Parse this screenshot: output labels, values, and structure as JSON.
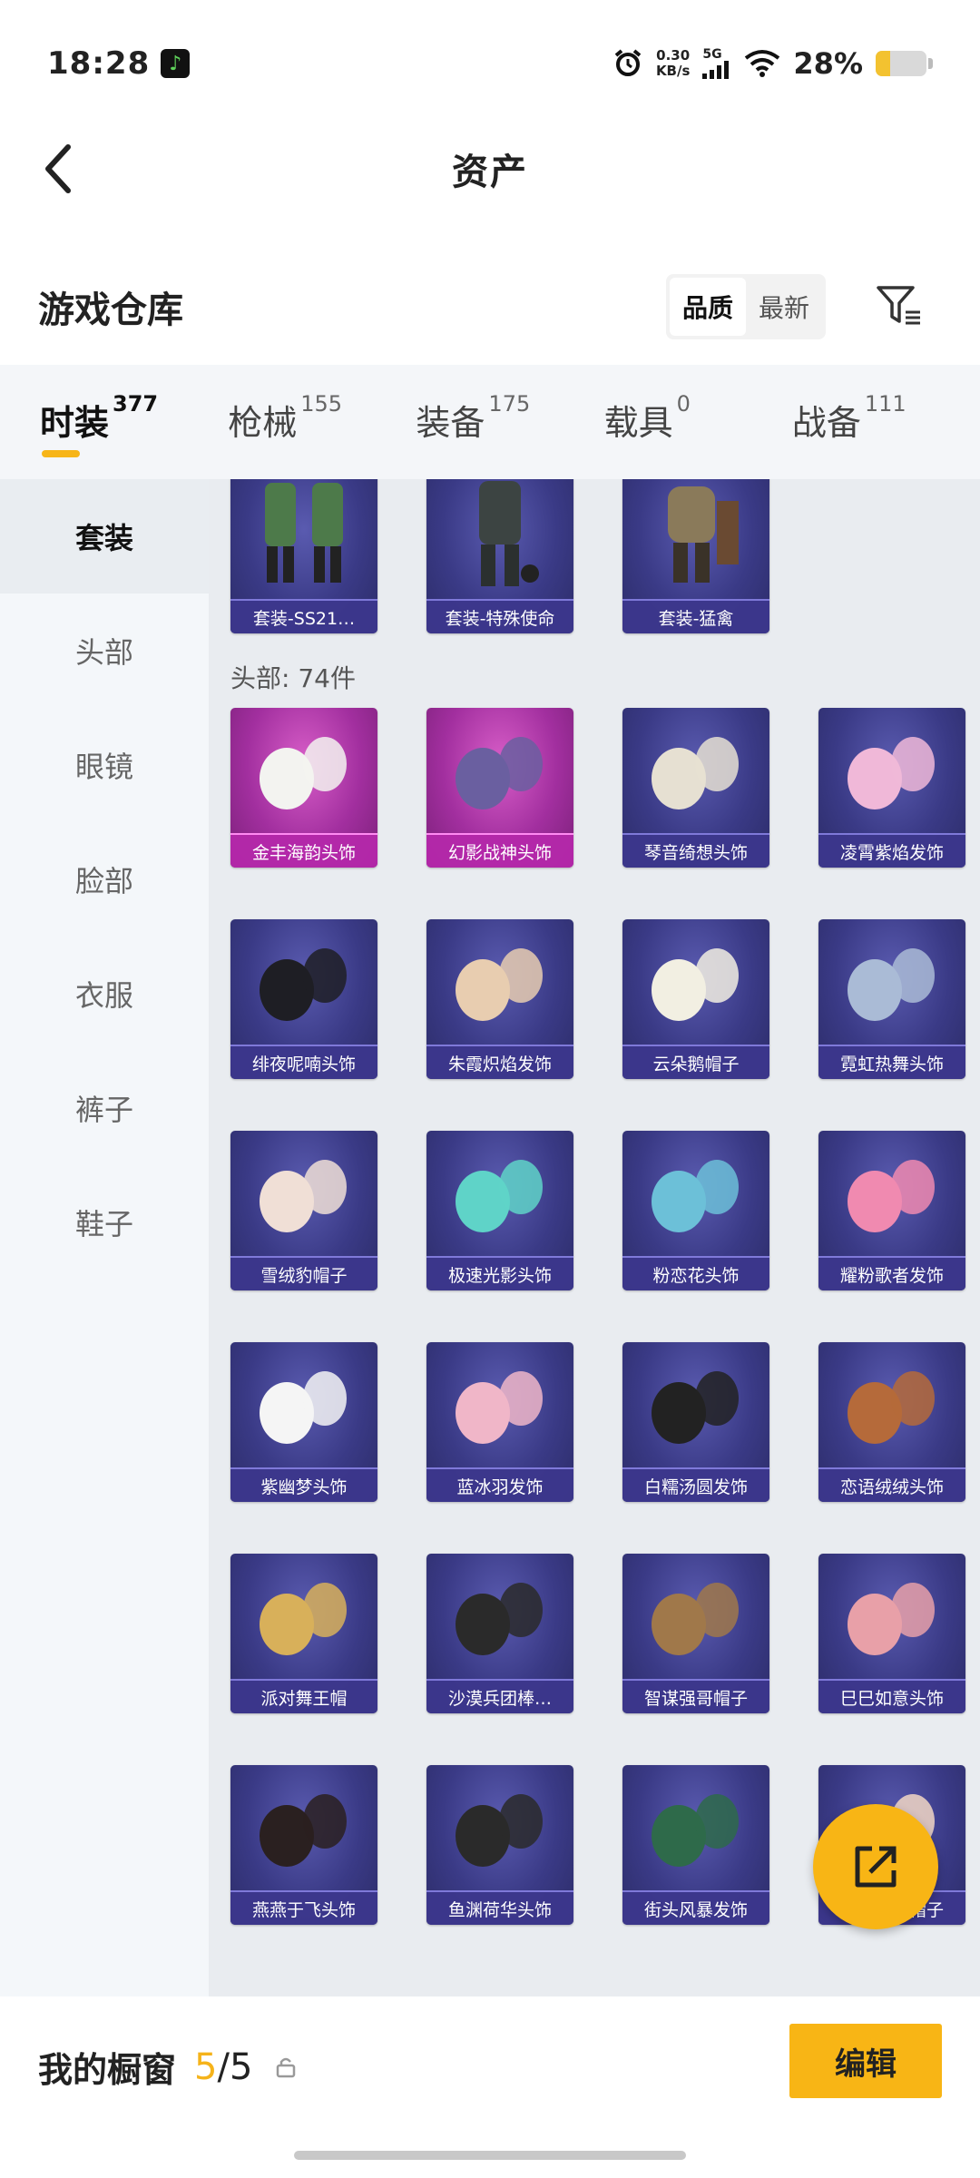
{
  "status": {
    "time": "18:28",
    "net_speed_top": "0.30",
    "net_speed_unit": "KB/s",
    "network": "5G",
    "battery_percent": "28%",
    "battery_level": 0.28
  },
  "header": {
    "title": "资产"
  },
  "warehouse": {
    "title": "游戏仓库",
    "sort_options": [
      "品质",
      "最新"
    ]
  },
  "category_tabs": [
    {
      "label": "时装",
      "count": "377"
    },
    {
      "label": "枪械",
      "count": "155"
    },
    {
      "label": "装备",
      "count": "175"
    },
    {
      "label": "载具",
      "count": "0"
    },
    {
      "label": "战备",
      "count": "111"
    }
  ],
  "sidebar": [
    "套装",
    "头部",
    "眼镜",
    "脸部",
    "衣服",
    "裤子",
    "鞋子"
  ],
  "sets": [
    "套装-SS21…",
    "套装-特殊使命",
    "套装-猛禽"
  ],
  "head_section_label": "头部: 74件",
  "head_items": [
    [
      "金丰海韵头饰",
      "幻影战神头饰",
      "琴音绮想头饰",
      "凌霄紫焰发饰"
    ],
    [
      "绯夜呢喃头饰",
      "朱霞炽焰发饰",
      "云朵鹅帽子",
      "霓虹热舞头饰"
    ],
    [
      "雪绒豹帽子",
      "极速光影头饰",
      "粉恋花头饰",
      "耀粉歌者发饰"
    ],
    [
      "紫幽梦头饰",
      "蓝冰羽发饰",
      "白糯汤圆发饰",
      "恋语绒绒头饰"
    ],
    [
      "派对舞王帽",
      "沙漠兵团棒…",
      "智谋强哥帽子",
      "巳巳如意头饰"
    ],
    [
      "燕燕于飞头饰",
      "鱼渊荷华头饰",
      "街头风暴发饰",
      "棉花软糖帽子"
    ]
  ],
  "showcase": {
    "label": "我的橱窗",
    "current": "5",
    "separator": "/",
    "total": "5"
  },
  "edit_label": "编辑"
}
